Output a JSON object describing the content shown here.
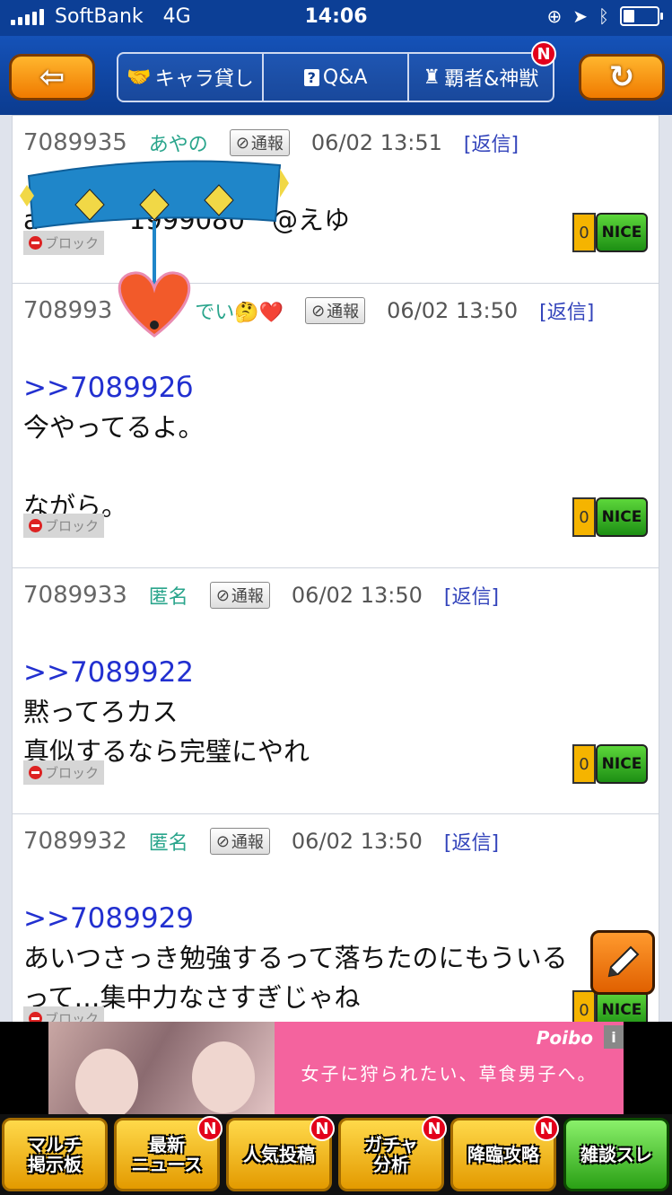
{
  "status_bar": {
    "carrier": "SoftBank",
    "network": "4G",
    "time": "14:06"
  },
  "nav": {
    "tabs": [
      {
        "label": "キャラ貸し",
        "icon": "handshake-icon"
      },
      {
        "label": "Q&A",
        "icon": "question-icon"
      },
      {
        "label": "覇者&神獣",
        "icon": "tower-icon"
      }
    ],
    "tab_badge": "N"
  },
  "posts": [
    {
      "id": "7089935",
      "name": "あやの",
      "report": "通報",
      "date": "06/02 13:51",
      "reply": "[返信]",
      "body_partial_a": "a",
      "body_partial_b": "1999080",
      "body_partial_c": "@えゆ",
      "block": "ブロック",
      "nice_count": "0",
      "nice_label": "NICE"
    },
    {
      "id": "708993",
      "name": "でい🤔❤️",
      "report": "通報",
      "date": "06/02 13:50",
      "reply": "[返信]",
      "anchor": ">>708992б",
      "body": "今やってるよ。\n\nながら。",
      "block": "ブロック",
      "nice_count": "0",
      "nice_label": "NICE"
    },
    {
      "id": "7089933",
      "name": "匿名",
      "report": "通報",
      "date": "06/02 13:50",
      "reply": "[返信]",
      "anchor": ">>7089922",
      "body": "黙ってろカス\n真似するなら完璧にやれ",
      "block": "ブロック",
      "nice_count": "0",
      "nice_label": "NICE"
    },
    {
      "id": "7089932",
      "name": "匿名",
      "report": "通報",
      "date": "06/02 13:50",
      "reply": "[返信]",
      "anchor": ">>7089929",
      "body": "あいつさっき勉強するって落ちたのにもういる\nって…集中力なさすぎじゃね",
      "block": "ブロック",
      "nice_count": "0",
      "nice_label": "NICE"
    }
  ],
  "ad": {
    "logo": "Poibo",
    "info": "i",
    "copy": "女子に狩られたい、草食男子へ。"
  },
  "bottom_nav": [
    {
      "label": "マルチ\n掲示板",
      "badge": ""
    },
    {
      "label": "最新\nニュース",
      "badge": "N"
    },
    {
      "label": "人気投稿",
      "badge": "N"
    },
    {
      "label": "ガチャ\n分析",
      "badge": "N"
    },
    {
      "label": "降臨攻略",
      "badge": "N"
    },
    {
      "label": "雑談スレ",
      "badge": ""
    }
  ]
}
